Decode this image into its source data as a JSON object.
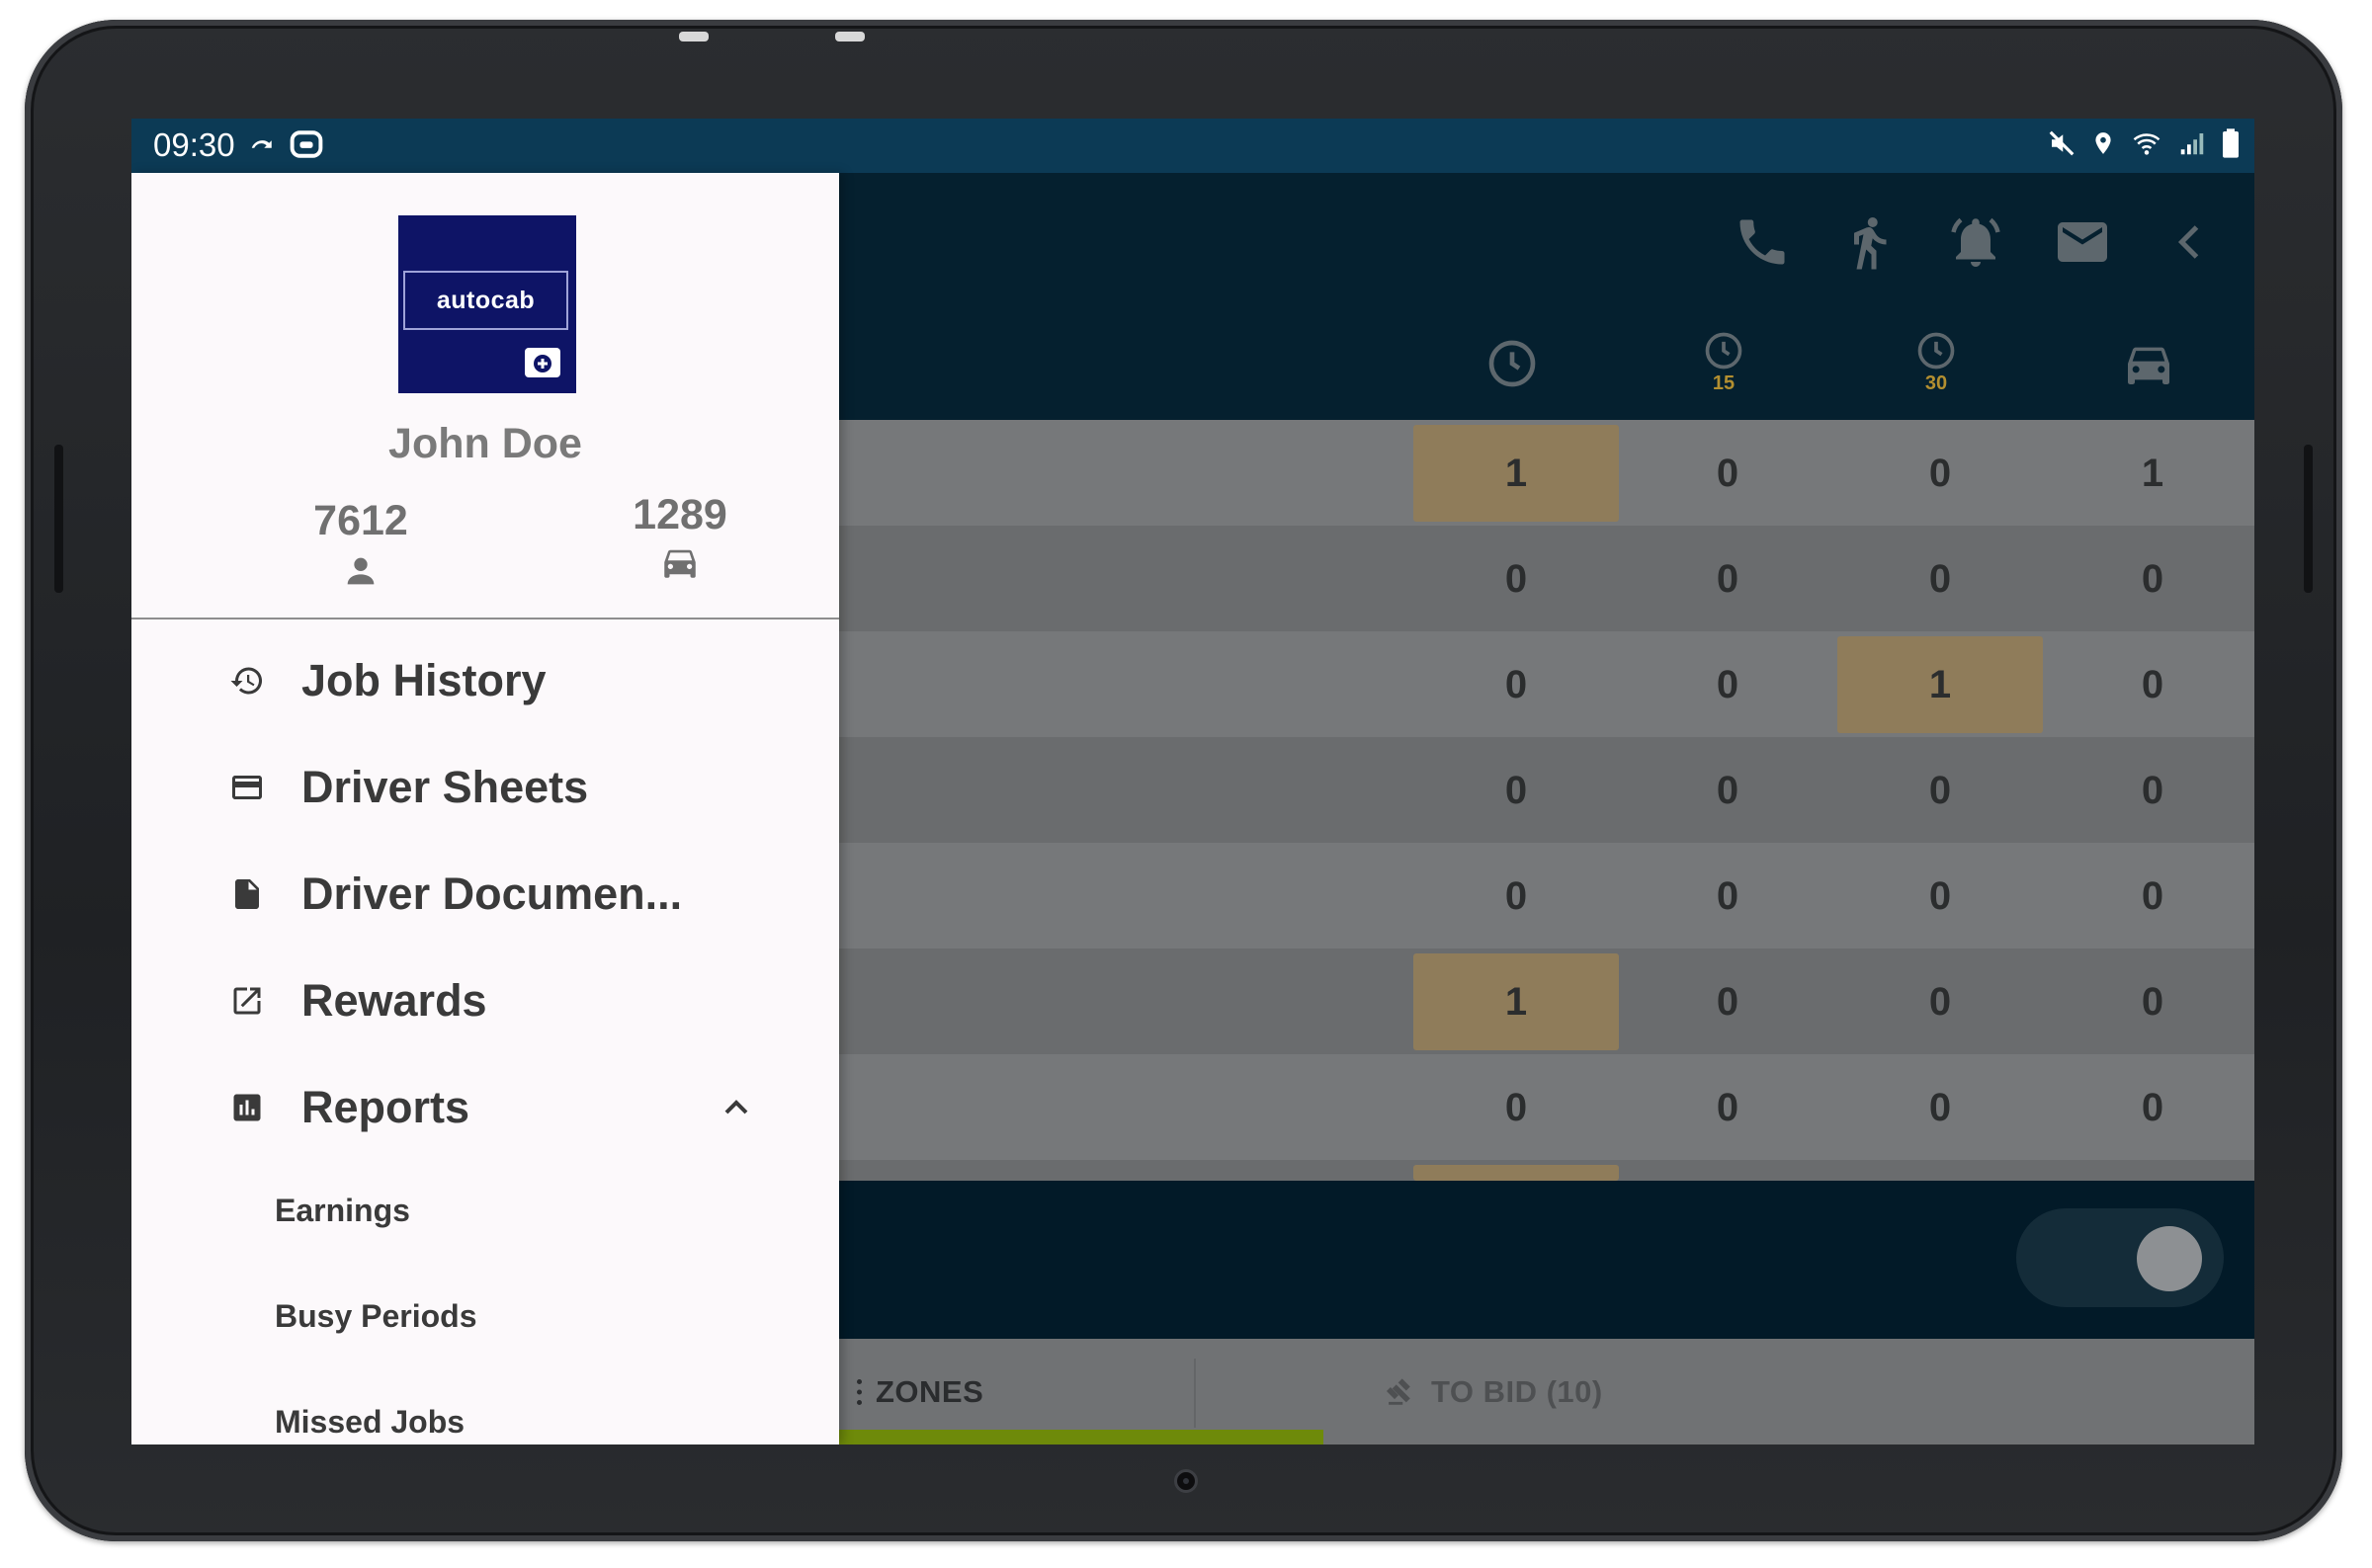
{
  "status_bar": {
    "time": "09:30"
  },
  "drawer": {
    "logo_text": "autocab",
    "user_name": "John Doe",
    "stats": [
      {
        "value": "7612",
        "icon": "person-icon"
      },
      {
        "value": "1289",
        "icon": "car-icon"
      }
    ],
    "menu": [
      {
        "label": "Job History",
        "icon": "history-icon"
      },
      {
        "label": "Driver Sheets",
        "icon": "card-icon"
      },
      {
        "label": "Driver Documen...",
        "icon": "document-icon"
      },
      {
        "label": "Rewards",
        "icon": "external-link-icon"
      },
      {
        "label": "Reports",
        "icon": "bar-chart-icon",
        "expanded": true
      }
    ],
    "report_items": [
      "Earnings",
      "Busy Periods",
      "Missed Jobs"
    ]
  },
  "header": {
    "column_headers": [
      {
        "icon": "clock-icon",
        "sub": ""
      },
      {
        "icon": "clock-icon",
        "sub": "15"
      },
      {
        "icon": "clock-icon",
        "sub": "30"
      },
      {
        "icon": "car-icon",
        "sub": ""
      }
    ]
  },
  "grid": {
    "rows": [
      [
        "1",
        "0",
        "0",
        "1"
      ],
      [
        "0",
        "0",
        "0",
        "0"
      ],
      [
        "0",
        "0",
        "1",
        "0"
      ],
      [
        "0",
        "0",
        "0",
        "0"
      ],
      [
        "0",
        "0",
        "0",
        "0"
      ],
      [
        "1",
        "0",
        "0",
        "0"
      ],
      [
        "0",
        "0",
        "0",
        "0"
      ]
    ],
    "highlighted": [
      [
        0,
        0
      ],
      [
        2,
        2
      ],
      [
        5,
        0
      ]
    ]
  },
  "tabs": [
    {
      "label": "ZONES",
      "active": true
    },
    {
      "label": "TO BID (10)",
      "active": false
    }
  ],
  "colors": {
    "status_bar": "#0c3a55",
    "header": "#05202f",
    "highlight": "#8f7c5a",
    "column_sub_label": "#b38f30",
    "tab_indicator": "#6e8a0a",
    "logo_bg": "#0e1466"
  }
}
